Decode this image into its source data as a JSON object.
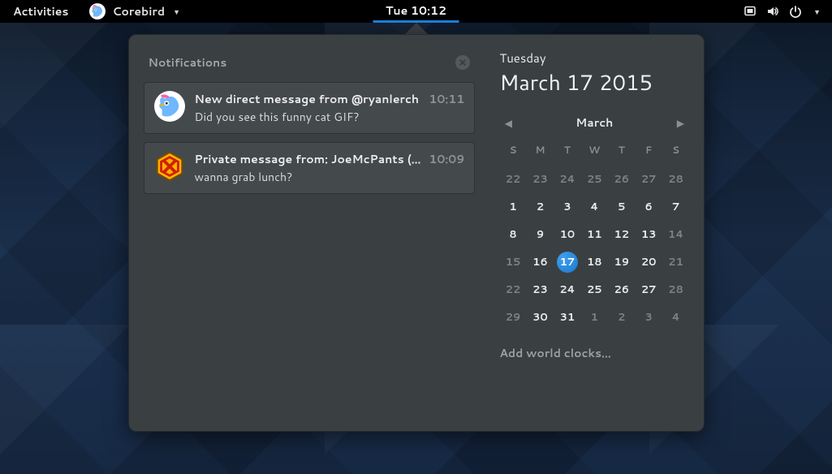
{
  "topbar": {
    "activities": "Activities",
    "app_name": "Corebird",
    "clock": "Tue 10:12"
  },
  "notifications": {
    "title": "Notifications",
    "items": [
      {
        "title": "New direct message from @ryanlerch",
        "time": "10:11",
        "body": "Did you see this funny cat GIF?"
      },
      {
        "title": "Private message from: JoeMcPants (...",
        "time": "10:09",
        "body": "wanna grab lunch?"
      }
    ]
  },
  "calendar": {
    "dayname": "Tuesday",
    "full_date": "March 17 2015",
    "month_label": "March",
    "dow": [
      "S",
      "M",
      "T",
      "W",
      "T",
      "F",
      "S"
    ],
    "weeks": [
      [
        {
          "n": "22",
          "muted": true
        },
        {
          "n": "23",
          "muted": true
        },
        {
          "n": "24",
          "muted": true
        },
        {
          "n": "25",
          "muted": true
        },
        {
          "n": "26",
          "muted": true
        },
        {
          "n": "27",
          "muted": true
        },
        {
          "n": "28",
          "muted": true
        }
      ],
      [
        {
          "n": "1"
        },
        {
          "n": "2"
        },
        {
          "n": "3"
        },
        {
          "n": "4"
        },
        {
          "n": "5"
        },
        {
          "n": "6"
        },
        {
          "n": "7"
        }
      ],
      [
        {
          "n": "8"
        },
        {
          "n": "9"
        },
        {
          "n": "10"
        },
        {
          "n": "11"
        },
        {
          "n": "12"
        },
        {
          "n": "13"
        },
        {
          "n": "14",
          "muted": true
        }
      ],
      [
        {
          "n": "15",
          "muted": true
        },
        {
          "n": "16"
        },
        {
          "n": "17",
          "today": true
        },
        {
          "n": "18"
        },
        {
          "n": "19"
        },
        {
          "n": "20"
        },
        {
          "n": "21",
          "muted": true
        }
      ],
      [
        {
          "n": "22",
          "muted": true
        },
        {
          "n": "23"
        },
        {
          "n": "24"
        },
        {
          "n": "25"
        },
        {
          "n": "26"
        },
        {
          "n": "27"
        },
        {
          "n": "28",
          "muted": true
        }
      ],
      [
        {
          "n": "29",
          "muted": true
        },
        {
          "n": "30"
        },
        {
          "n": "31"
        },
        {
          "n": "1",
          "muted": true
        },
        {
          "n": "2",
          "muted": true
        },
        {
          "n": "3",
          "muted": true
        },
        {
          "n": "4",
          "muted": true
        }
      ]
    ],
    "add_clocks": "Add world clocks..."
  }
}
